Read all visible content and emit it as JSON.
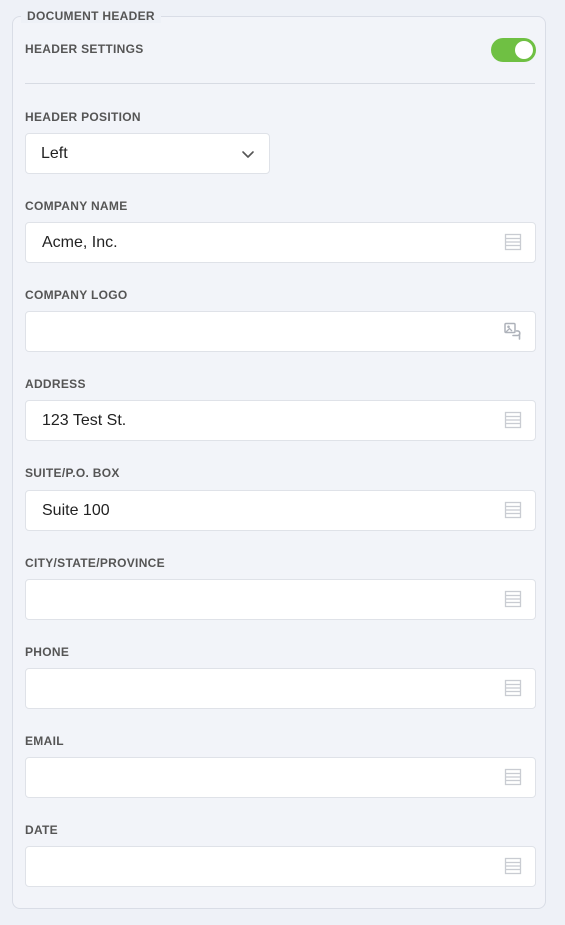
{
  "section": {
    "title": "DOCUMENT HEADER"
  },
  "header_settings": {
    "label": "HEADER SETTINGS",
    "enabled": true,
    "toggle_color": "#6fc043"
  },
  "header_position": {
    "label": "HEADER POSITION",
    "value": "Left",
    "icon": "chevron-down-icon"
  },
  "fields": {
    "company_name": {
      "label": "COMPANY NAME",
      "value": "Acme, Inc.",
      "icon": "list-icon"
    },
    "company_logo": {
      "label": "COMPANY LOGO",
      "value": "",
      "icon": "image-link-icon"
    },
    "address": {
      "label": "ADDRESS",
      "value": "123 Test St.",
      "icon": "list-icon"
    },
    "suite": {
      "label": "SUITE/P.O. BOX",
      "value": "Suite 100",
      "icon": "list-icon"
    },
    "city": {
      "label": "CITY/STATE/PROVINCE",
      "value": "",
      "icon": "list-icon"
    },
    "phone": {
      "label": "PHONE",
      "value": "",
      "icon": "list-icon"
    },
    "email": {
      "label": "EMAIL",
      "value": "",
      "icon": "list-icon"
    },
    "date": {
      "label": "DATE",
      "value": "",
      "icon": "list-icon"
    }
  }
}
